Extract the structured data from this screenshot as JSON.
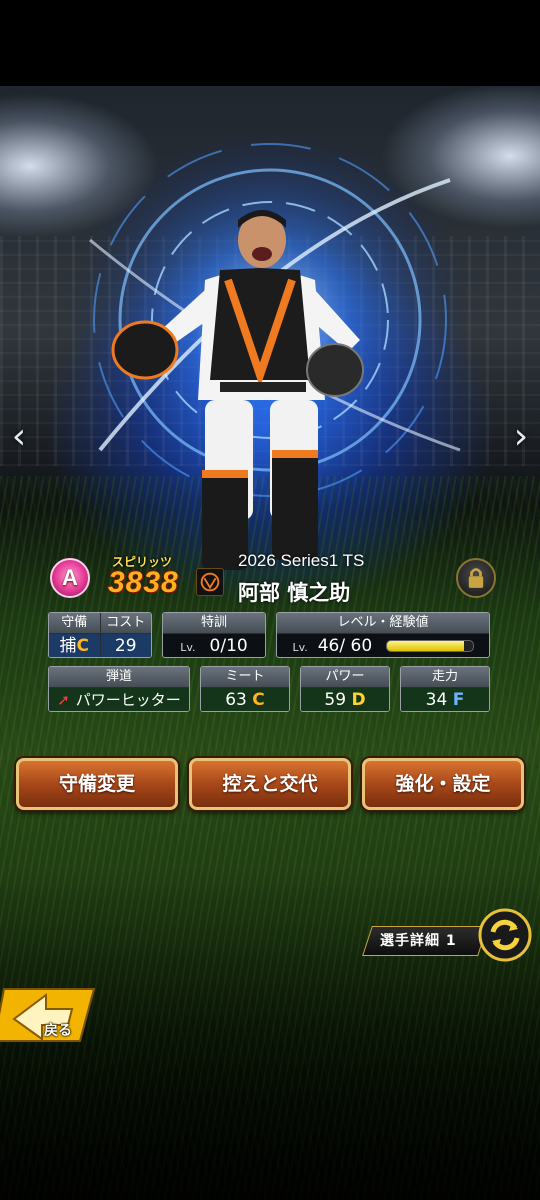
{
  "card": {
    "rank": "A",
    "spirits_label": "スピリッツ",
    "spirits_value": "3838",
    "series": "2026 Series1 TS",
    "name": "阿部 慎之助"
  },
  "stats": {
    "defense": {
      "label": "守備",
      "position": "捕",
      "grade": "C"
    },
    "cost": {
      "label": "コスト",
      "value": "29"
    },
    "training": {
      "label": "特訓",
      "lv_prefix": "Lv.",
      "value": "0/10"
    },
    "level": {
      "label": "レベル・経験値",
      "lv_prefix": "Lv.",
      "value": "46/",
      "max": "60",
      "exp_fraction": 0.9
    },
    "trajectory": {
      "label": "弾道",
      "value": "パワーヒッター"
    },
    "meet": {
      "label": "ミート",
      "value": "63",
      "grade": "C"
    },
    "power": {
      "label": "パワー",
      "value": "59",
      "grade": "D"
    },
    "speed": {
      "label": "走力",
      "value": "34",
      "grade": "F"
    }
  },
  "actions": {
    "defense_change": "守備変更",
    "bench_swap": "控えと交代",
    "enhance_settings": "強化・設定"
  },
  "detail_button": "選手詳細 1",
  "back_button": "戻る",
  "nav": {
    "prev": "‹",
    "next": "›"
  },
  "colors": {
    "accent_orange": "#a8481a",
    "gold_border": "#e7c47a",
    "rank_pink": "#e43a94"
  }
}
